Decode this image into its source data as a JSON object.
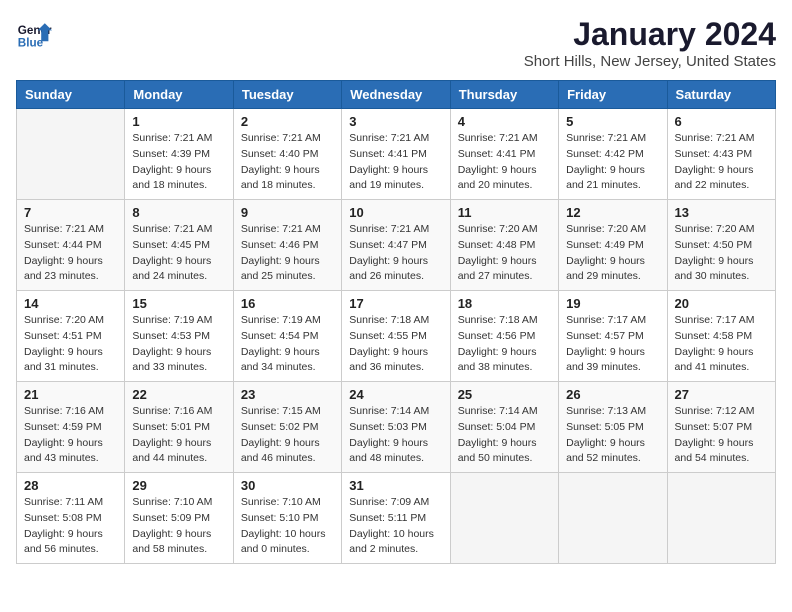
{
  "header": {
    "logo_line1": "General",
    "logo_line2": "Blue",
    "month": "January 2024",
    "location": "Short Hills, New Jersey, United States"
  },
  "days_of_week": [
    "Sunday",
    "Monday",
    "Tuesday",
    "Wednesday",
    "Thursday",
    "Friday",
    "Saturday"
  ],
  "weeks": [
    [
      {
        "day": "",
        "info": ""
      },
      {
        "day": "1",
        "info": "Sunrise: 7:21 AM\nSunset: 4:39 PM\nDaylight: 9 hours\nand 18 minutes."
      },
      {
        "day": "2",
        "info": "Sunrise: 7:21 AM\nSunset: 4:40 PM\nDaylight: 9 hours\nand 18 minutes."
      },
      {
        "day": "3",
        "info": "Sunrise: 7:21 AM\nSunset: 4:41 PM\nDaylight: 9 hours\nand 19 minutes."
      },
      {
        "day": "4",
        "info": "Sunrise: 7:21 AM\nSunset: 4:41 PM\nDaylight: 9 hours\nand 20 minutes."
      },
      {
        "day": "5",
        "info": "Sunrise: 7:21 AM\nSunset: 4:42 PM\nDaylight: 9 hours\nand 21 minutes."
      },
      {
        "day": "6",
        "info": "Sunrise: 7:21 AM\nSunset: 4:43 PM\nDaylight: 9 hours\nand 22 minutes."
      }
    ],
    [
      {
        "day": "7",
        "info": "Sunrise: 7:21 AM\nSunset: 4:44 PM\nDaylight: 9 hours\nand 23 minutes."
      },
      {
        "day": "8",
        "info": "Sunrise: 7:21 AM\nSunset: 4:45 PM\nDaylight: 9 hours\nand 24 minutes."
      },
      {
        "day": "9",
        "info": "Sunrise: 7:21 AM\nSunset: 4:46 PM\nDaylight: 9 hours\nand 25 minutes."
      },
      {
        "day": "10",
        "info": "Sunrise: 7:21 AM\nSunset: 4:47 PM\nDaylight: 9 hours\nand 26 minutes."
      },
      {
        "day": "11",
        "info": "Sunrise: 7:20 AM\nSunset: 4:48 PM\nDaylight: 9 hours\nand 27 minutes."
      },
      {
        "day": "12",
        "info": "Sunrise: 7:20 AM\nSunset: 4:49 PM\nDaylight: 9 hours\nand 29 minutes."
      },
      {
        "day": "13",
        "info": "Sunrise: 7:20 AM\nSunset: 4:50 PM\nDaylight: 9 hours\nand 30 minutes."
      }
    ],
    [
      {
        "day": "14",
        "info": "Sunrise: 7:20 AM\nSunset: 4:51 PM\nDaylight: 9 hours\nand 31 minutes."
      },
      {
        "day": "15",
        "info": "Sunrise: 7:19 AM\nSunset: 4:53 PM\nDaylight: 9 hours\nand 33 minutes."
      },
      {
        "day": "16",
        "info": "Sunrise: 7:19 AM\nSunset: 4:54 PM\nDaylight: 9 hours\nand 34 minutes."
      },
      {
        "day": "17",
        "info": "Sunrise: 7:18 AM\nSunset: 4:55 PM\nDaylight: 9 hours\nand 36 minutes."
      },
      {
        "day": "18",
        "info": "Sunrise: 7:18 AM\nSunset: 4:56 PM\nDaylight: 9 hours\nand 38 minutes."
      },
      {
        "day": "19",
        "info": "Sunrise: 7:17 AM\nSunset: 4:57 PM\nDaylight: 9 hours\nand 39 minutes."
      },
      {
        "day": "20",
        "info": "Sunrise: 7:17 AM\nSunset: 4:58 PM\nDaylight: 9 hours\nand 41 minutes."
      }
    ],
    [
      {
        "day": "21",
        "info": "Sunrise: 7:16 AM\nSunset: 4:59 PM\nDaylight: 9 hours\nand 43 minutes."
      },
      {
        "day": "22",
        "info": "Sunrise: 7:16 AM\nSunset: 5:01 PM\nDaylight: 9 hours\nand 44 minutes."
      },
      {
        "day": "23",
        "info": "Sunrise: 7:15 AM\nSunset: 5:02 PM\nDaylight: 9 hours\nand 46 minutes."
      },
      {
        "day": "24",
        "info": "Sunrise: 7:14 AM\nSunset: 5:03 PM\nDaylight: 9 hours\nand 48 minutes."
      },
      {
        "day": "25",
        "info": "Sunrise: 7:14 AM\nSunset: 5:04 PM\nDaylight: 9 hours\nand 50 minutes."
      },
      {
        "day": "26",
        "info": "Sunrise: 7:13 AM\nSunset: 5:05 PM\nDaylight: 9 hours\nand 52 minutes."
      },
      {
        "day": "27",
        "info": "Sunrise: 7:12 AM\nSunset: 5:07 PM\nDaylight: 9 hours\nand 54 minutes."
      }
    ],
    [
      {
        "day": "28",
        "info": "Sunrise: 7:11 AM\nSunset: 5:08 PM\nDaylight: 9 hours\nand 56 minutes."
      },
      {
        "day": "29",
        "info": "Sunrise: 7:10 AM\nSunset: 5:09 PM\nDaylight: 9 hours\nand 58 minutes."
      },
      {
        "day": "30",
        "info": "Sunrise: 7:10 AM\nSunset: 5:10 PM\nDaylight: 10 hours\nand 0 minutes."
      },
      {
        "day": "31",
        "info": "Sunrise: 7:09 AM\nSunset: 5:11 PM\nDaylight: 10 hours\nand 2 minutes."
      },
      {
        "day": "",
        "info": ""
      },
      {
        "day": "",
        "info": ""
      },
      {
        "day": "",
        "info": ""
      }
    ]
  ]
}
